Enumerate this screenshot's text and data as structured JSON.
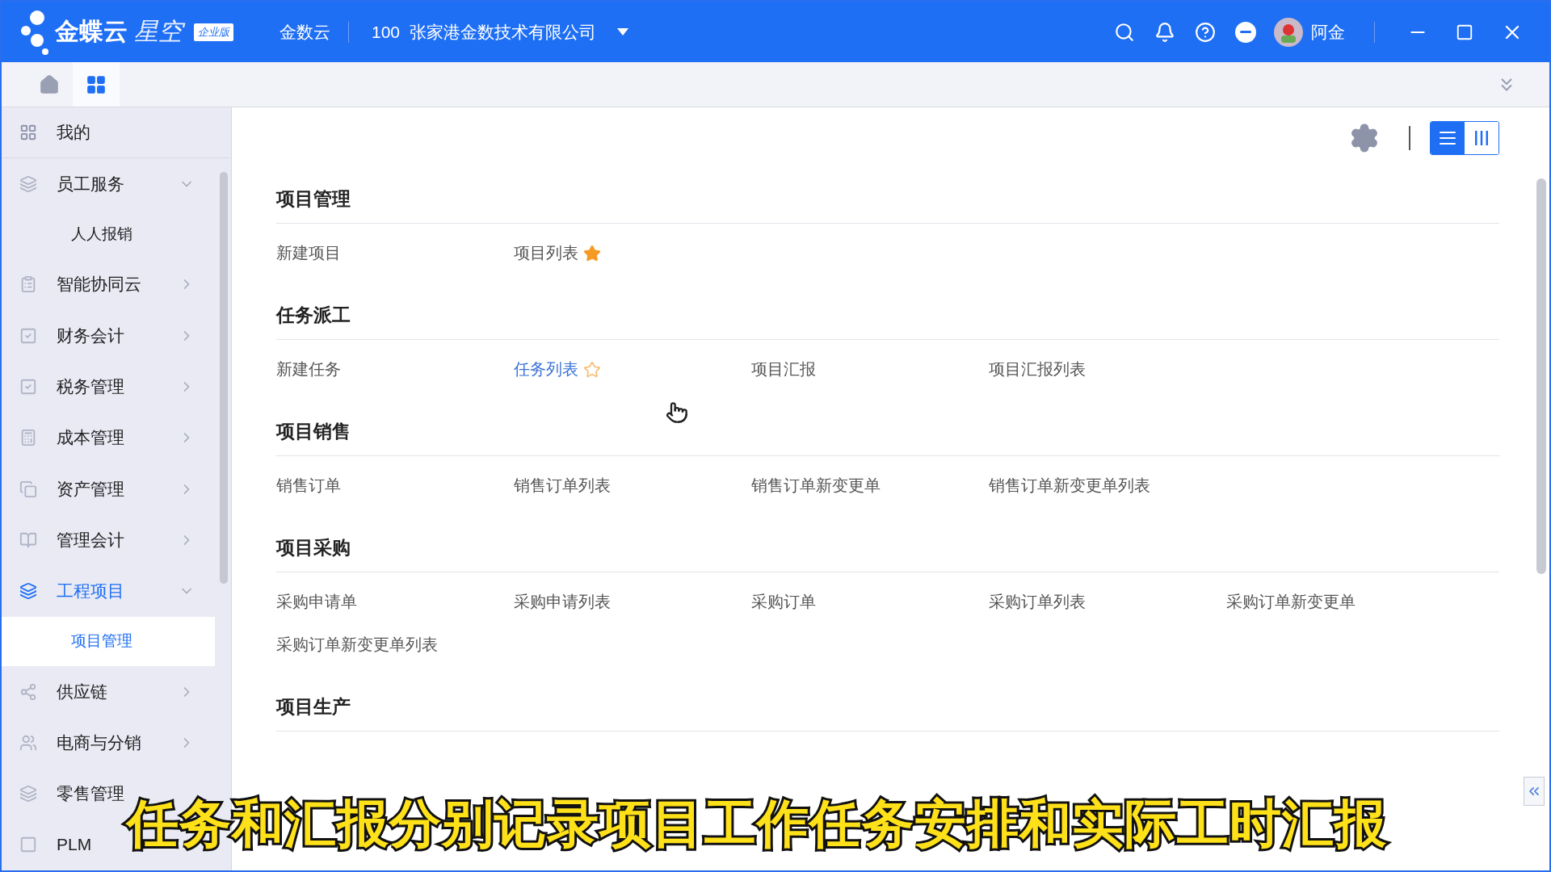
{
  "header": {
    "logo": {
      "name": "金蝶云",
      "sub": "星空",
      "badge": "企业版"
    },
    "app_name": "金数云",
    "org_code": "100",
    "org_name": "张家港金数技术有限公司",
    "user": "阿金"
  },
  "tabs": [
    {
      "kind": "home",
      "selected": false
    },
    {
      "kind": "apps",
      "selected": true
    }
  ],
  "sidebar": {
    "pinned": {
      "label": "我的"
    },
    "items": [
      {
        "label": "员工服务",
        "expanded": true,
        "selected": false,
        "children": [
          {
            "label": "人人报销",
            "selected": false
          }
        ]
      },
      {
        "label": "智能协同云",
        "expanded": false,
        "selected": false
      },
      {
        "label": "财务会计",
        "expanded": false,
        "selected": false
      },
      {
        "label": "税务管理",
        "expanded": false,
        "selected": false
      },
      {
        "label": "成本管理",
        "expanded": false,
        "selected": false
      },
      {
        "label": "资产管理",
        "expanded": false,
        "selected": false
      },
      {
        "label": "管理会计",
        "expanded": false,
        "selected": false
      },
      {
        "label": "工程项目",
        "expanded": true,
        "selected": true,
        "children": [
          {
            "label": "项目管理",
            "selected": true
          }
        ]
      },
      {
        "label": "供应链",
        "expanded": false,
        "selected": false
      },
      {
        "label": "电商与分销",
        "expanded": false,
        "selected": false
      },
      {
        "label": "零售管理",
        "selected": false
      },
      {
        "label": "PLM",
        "selected": false
      }
    ]
  },
  "view_toggle": [
    {
      "kind": "list",
      "selected": true
    },
    {
      "kind": "columns",
      "selected": false
    }
  ],
  "sections": [
    {
      "title": "项目管理",
      "items": [
        {
          "label": "新建项目",
          "kind": "plain",
          "hover": false
        },
        {
          "label": "项目列表",
          "kind": "favorite",
          "starred": true,
          "hover": false
        }
      ]
    },
    {
      "title": "任务派工",
      "items": [
        {
          "label": "新建任务",
          "kind": "plain",
          "hover": false
        },
        {
          "label": "任务列表",
          "kind": "favorite",
          "starred": false,
          "hover": true
        },
        {
          "label": "项目汇报",
          "kind": "plain",
          "hover": false
        },
        {
          "label": "项目汇报列表",
          "kind": "plain",
          "hover": false
        }
      ]
    },
    {
      "title": "项目销售",
      "items": [
        {
          "label": "销售订单",
          "kind": "plain",
          "hover": false
        },
        {
          "label": "销售订单列表",
          "kind": "plain",
          "hover": false
        },
        {
          "label": "销售订单新变更单",
          "kind": "plain",
          "hover": false
        },
        {
          "label": "销售订单新变更单列表",
          "kind": "plain",
          "hover": false
        }
      ]
    },
    {
      "title": "项目采购",
      "items": [
        {
          "label": "采购申请单",
          "kind": "plain",
          "hover": false
        },
        {
          "label": "采购申请列表",
          "kind": "plain",
          "hover": false
        },
        {
          "label": "采购订单",
          "kind": "plain",
          "hover": false
        },
        {
          "label": "采购订单列表",
          "kind": "plain",
          "hover": false
        },
        {
          "label": "采购订单新变更单",
          "kind": "plain",
          "hover": false
        },
        {
          "label": "采购订单新变更单列表",
          "kind": "plain",
          "hover": false
        }
      ]
    },
    {
      "title": "项目生产"
    }
  ],
  "subtitle": "任务和汇报分别记录项目工作任务安排和实际工时汇报"
}
